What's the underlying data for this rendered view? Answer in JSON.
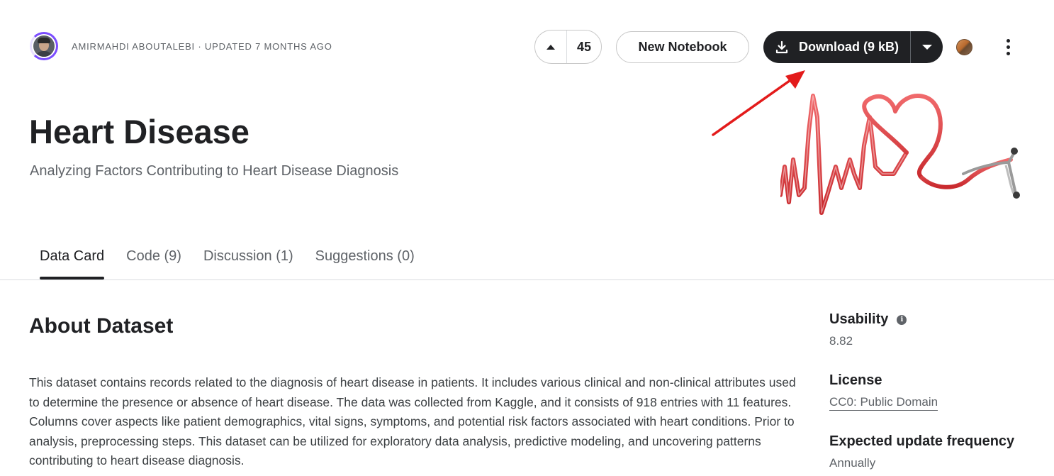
{
  "header": {
    "author_meta": "AMIRMAHDI ABOUTALEBI · UPDATED 7 MONTHS AGO",
    "vote_count": "45",
    "new_notebook_label": "New Notebook",
    "download_label": "Download (9 kB)"
  },
  "hero": {
    "title": "Heart Disease",
    "subtitle": "Analyzing Factors Contributing to Heart Disease Diagnosis"
  },
  "tabs": [
    {
      "label": "Data Card",
      "active": true
    },
    {
      "label": "Code (9)",
      "active": false
    },
    {
      "label": "Discussion (1)",
      "active": false
    },
    {
      "label": "Suggestions (0)",
      "active": false
    }
  ],
  "about": {
    "heading": "About Dataset",
    "description": "This dataset contains records related to the diagnosis of heart disease in patients. It includes various clinical and non-clinical attributes used to determine the presence or absence of heart disease. The data was collected from Kaggle, and it consists of 918 entries with 11 features. Columns cover aspects like patient demographics, vital signs, symptoms, and potential risk factors associated with heart conditions. Prior to analysis, preprocessing steps. This dataset can be utilized for exploratory data analysis, predictive modeling, and uncovering patterns contributing to heart disease diagnosis."
  },
  "sidebar": {
    "usability_label": "Usability",
    "usability_value": "8.82",
    "license_label": "License",
    "license_value": "CC0: Public Domain",
    "frequency_label": "Expected update frequency",
    "frequency_value": "Annually"
  },
  "colors": {
    "primary": "#202124",
    "muted": "#5f6368",
    "annotation_arrow": "#e31b1b",
    "heart_line": "#d9383a"
  },
  "icons": {
    "upvote": "upvote-triangle-icon",
    "download": "download-icon",
    "dropdown": "caret-down-icon",
    "more": "more-vertical-icon",
    "info": "info-icon"
  }
}
